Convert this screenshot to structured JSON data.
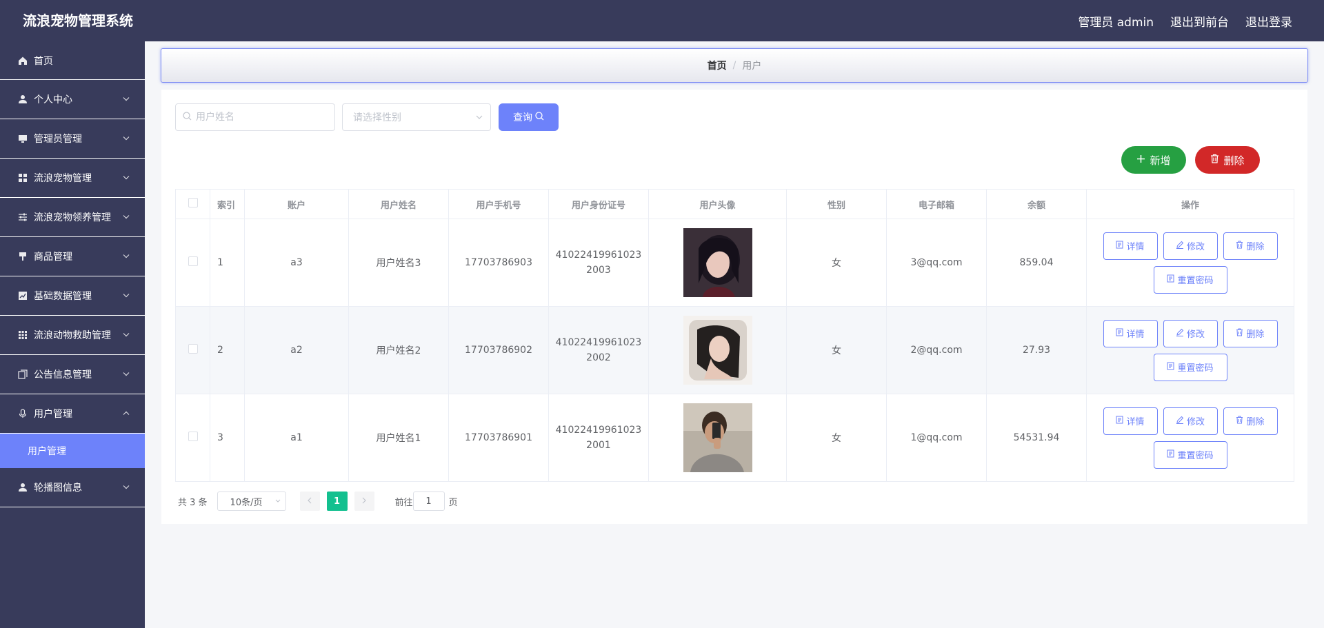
{
  "header": {
    "brand": "流浪宠物管理系统",
    "admin_label": "管理员 admin",
    "to_front": "退出到前台",
    "logout": "退出登录"
  },
  "sidebar": {
    "items": [
      {
        "label": "首页",
        "icon": "home-icon"
      },
      {
        "label": "个人中心",
        "icon": "user-icon"
      },
      {
        "label": "管理员管理",
        "icon": "monitor-icon"
      },
      {
        "label": "流浪宠物管理",
        "icon": "grid-icon"
      },
      {
        "label": "流浪宠物领养管理",
        "icon": "sliders-icon"
      },
      {
        "label": "商品管理",
        "icon": "brush-icon"
      },
      {
        "label": "基础数据管理",
        "icon": "chart-icon"
      },
      {
        "label": "流浪动物救助管理",
        "icon": "apps-icon"
      },
      {
        "label": "公告信息管理",
        "icon": "copy-icon"
      },
      {
        "label": "用户管理",
        "icon": "mic-icon"
      },
      {
        "label": "轮播图信息",
        "icon": "user-icon"
      }
    ],
    "active_sub": "用户管理"
  },
  "breadcrumb": {
    "home": "首页",
    "current": "用户"
  },
  "search": {
    "name_placeholder": "用户姓名",
    "gender_placeholder": "请选择性别",
    "query_label": "查询"
  },
  "actions": {
    "add": "新增",
    "delete": "删除"
  },
  "table": {
    "headers": [
      "索引",
      "账户",
      "用户姓名",
      "用户手机号",
      "用户身份证号",
      "用户头像",
      "性别",
      "电子邮箱",
      "余额",
      "操作"
    ],
    "rows": [
      {
        "index": "1",
        "account": "a3",
        "name": "用户姓名3",
        "phone": "17703786903",
        "idcard": "410224199610232003",
        "gender": "女",
        "email": "3@qq.com",
        "balance": "859.04"
      },
      {
        "index": "2",
        "account": "a2",
        "name": "用户姓名2",
        "phone": "17703786902",
        "idcard": "410224199610232002",
        "gender": "女",
        "email": "2@qq.com",
        "balance": "27.93"
      },
      {
        "index": "3",
        "account": "a1",
        "name": "用户姓名1",
        "phone": "17703786901",
        "idcard": "410224199610232001",
        "gender": "女",
        "email": "1@qq.com",
        "balance": "54531.94"
      }
    ],
    "ops": {
      "detail": "详情",
      "edit": "修改",
      "delete": "删除",
      "reset": "重置密码"
    }
  },
  "pagination": {
    "total": "共 3 条",
    "page_size": "10条/页",
    "current": "1",
    "goto_label": "前往",
    "goto_value": "1",
    "page_suffix": "页"
  },
  "colors": {
    "header_bg": "#383b5b",
    "accent": "#6d82fa",
    "add_green": "#26a042",
    "delete_red": "#d22828",
    "page_active": "#13c08f"
  }
}
